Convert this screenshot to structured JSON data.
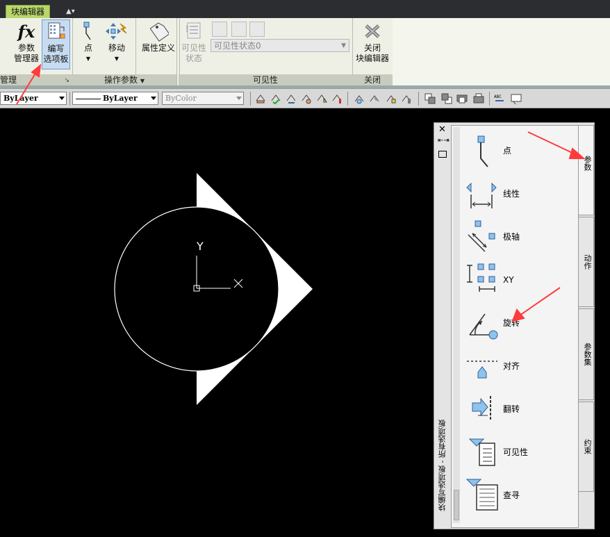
{
  "ribbon_tab": "块编辑器",
  "ribbon": {
    "panels": [
      {
        "title": "管理"
      },
      {
        "title": "操作参数"
      },
      {
        "title": "可见性"
      },
      {
        "title": "关闭"
      }
    ],
    "buttons": {
      "param_manager": "参数\n管理器",
      "author_palette": "编写\n选项板",
      "point": "点",
      "move": "移动",
      "attr_def": "属性定义",
      "visibility_state": "可见性\n状态",
      "close_editor": "关闭\n块编辑器"
    },
    "visibility_combo": "可见性状态0"
  },
  "properties_bar": {
    "layer": "ByLayer",
    "linetype": "ByLayer",
    "color": "ByColor"
  },
  "canvas": {
    "ucs_y_label": "Y"
  },
  "palette": {
    "title": "块编写选项板 - 所有选项板",
    "tabs": [
      "参数",
      "动作",
      "参数集",
      "约束"
    ],
    "tools": [
      {
        "label": "点",
        "icon": "point-param-icon"
      },
      {
        "label": "线性",
        "icon": "linear-param-icon"
      },
      {
        "label": "极轴",
        "icon": "polar-param-icon"
      },
      {
        "label": "XY",
        "icon": "xy-param-icon"
      },
      {
        "label": "旋转",
        "icon": "rotation-param-icon"
      },
      {
        "label": "对齐",
        "icon": "alignment-param-icon"
      },
      {
        "label": "翻转",
        "icon": "flip-param-icon"
      },
      {
        "label": "可见性",
        "icon": "visibility-param-icon"
      },
      {
        "label": "查寻",
        "icon": "lookup-param-icon"
      }
    ]
  },
  "colors": {
    "canvas": "#000000",
    "ribbon_tab": "#b8d66a",
    "annotation_arrow": "#ff3b3b",
    "param_icon_blue": "#8fc3ea"
  }
}
